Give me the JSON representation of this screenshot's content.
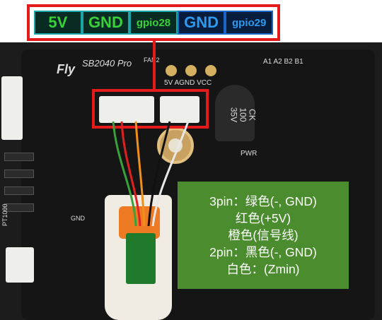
{
  "pin_labels": [
    {
      "text": "5V",
      "style": "green"
    },
    {
      "text": "GND",
      "style": "green"
    },
    {
      "text": "gpio28",
      "style": "green"
    },
    {
      "text": "GND",
      "style": "blue"
    },
    {
      "text": "gpio29",
      "style": "blue"
    }
  ],
  "board": {
    "logo": "Fly",
    "model": "SB2040 Pro",
    "fan_label": "FAN2",
    "top_pads": "5V AGND VCC",
    "top_right_pads": "A1 A2 B2 B1",
    "cap_text": "CK\n100\n35V",
    "pwr_label": "PWR",
    "gnd_label": "GND",
    "pt_label": "PT1000"
  },
  "info": {
    "lines": [
      "3pin：绿色(-, GND)",
      "红色(+5V)",
      "橙色(信号线)",
      "2pin：黑色(-, GND)",
      "白色：(Zmin)"
    ]
  },
  "colors": {
    "callout": "#e51b1b",
    "info_bg": "#4a8c2e",
    "wire_green": "#3aa03a",
    "wire_red": "#e02020",
    "wire_orange": "#f0901a",
    "wire_black": "#111111",
    "wire_white": "#e8e8e8"
  }
}
